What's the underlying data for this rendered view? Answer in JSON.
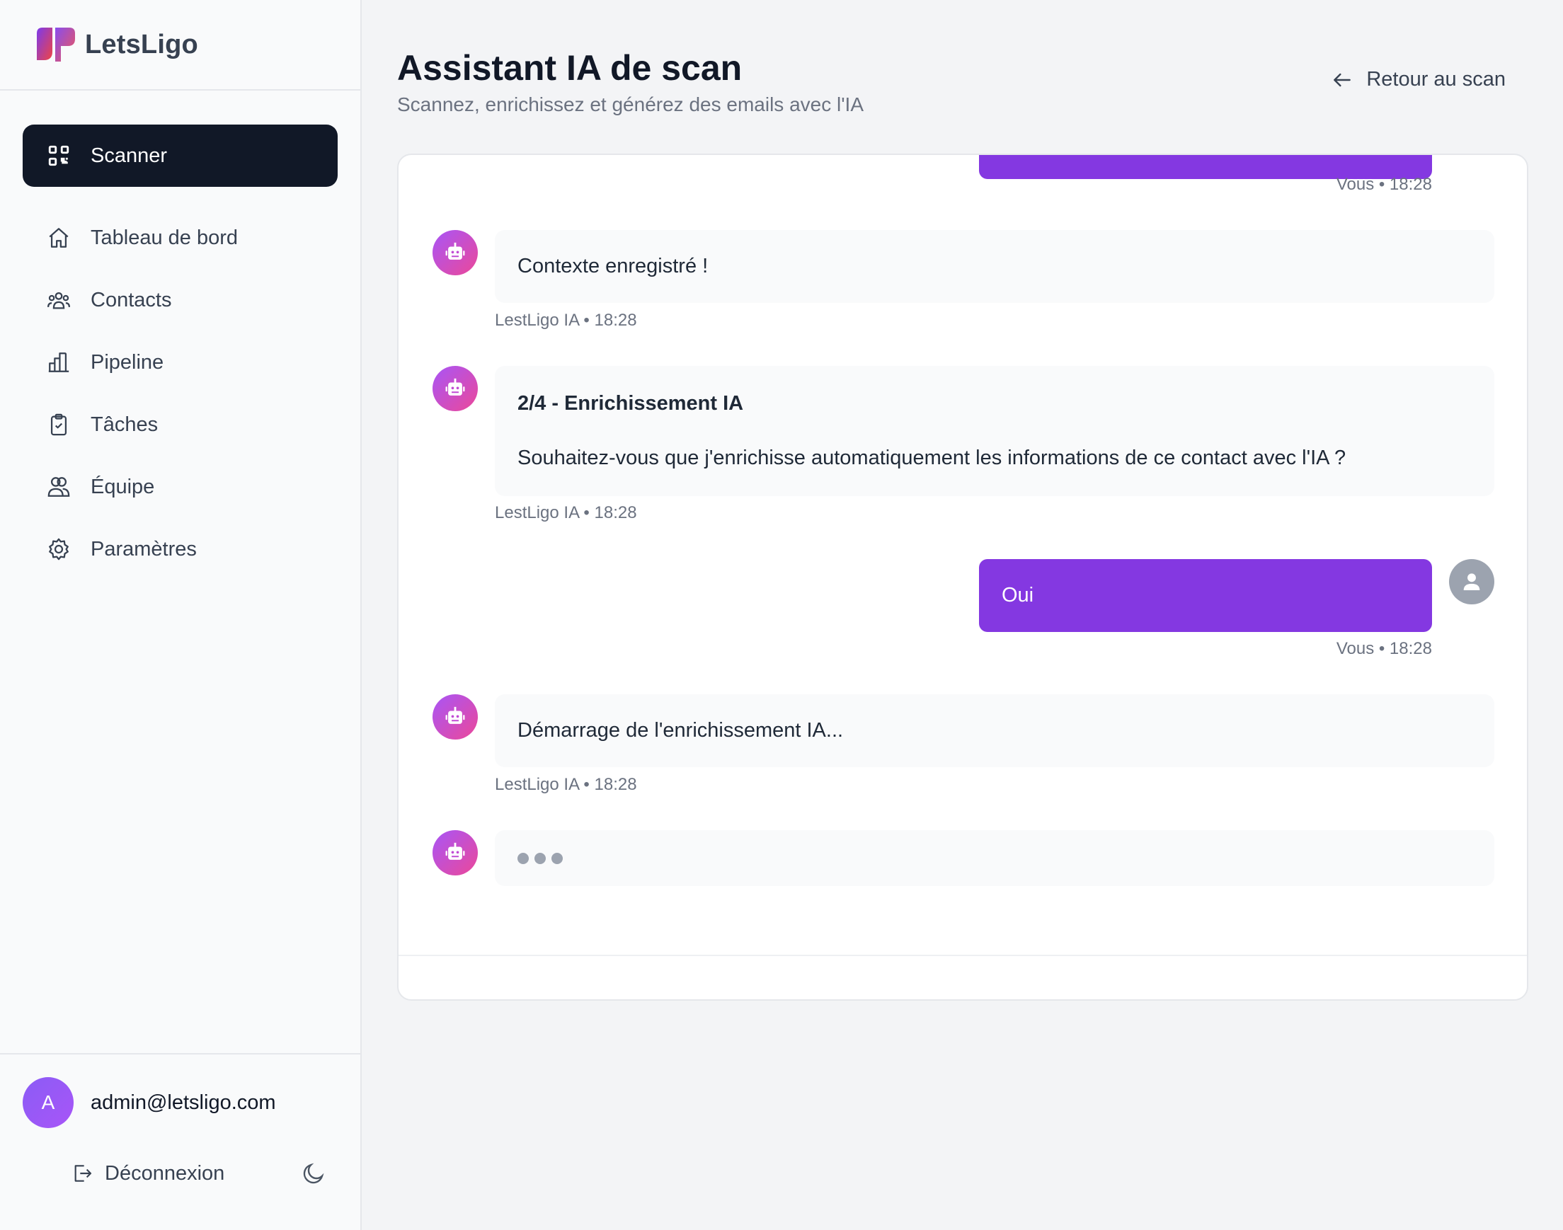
{
  "brand": {
    "name": "LetsLigo"
  },
  "sidebar": {
    "items": [
      {
        "label": "Scanner",
        "icon": "qr-scan-icon",
        "active": true
      },
      {
        "label": "Tableau de bord",
        "icon": "home-icon"
      },
      {
        "label": "Contacts",
        "icon": "users-icon"
      },
      {
        "label": "Pipeline",
        "icon": "bar-chart-icon"
      },
      {
        "label": "Tâches",
        "icon": "clipboard-check-icon"
      },
      {
        "label": "Équipe",
        "icon": "team-icon"
      },
      {
        "label": "Paramètres",
        "icon": "gear-icon"
      }
    ]
  },
  "user": {
    "initial": "A",
    "email": "admin@letsligo.com",
    "logout_label": "Déconnexion"
  },
  "header": {
    "title": "Assistant IA de scan",
    "subtitle": "Scannez, enrichissez et générez des emails avec l'IA",
    "back_label": "Retour au scan"
  },
  "chat": {
    "messages": [
      {
        "from": "user",
        "text": "",
        "meta": "Vous • 18:28"
      },
      {
        "from": "bot",
        "text": "Contexte enregistré !",
        "meta": "LestLigo IA • 18:28"
      },
      {
        "from": "bot",
        "title": "2/4 - Enrichissement IA",
        "text": "Souhaitez-vous que j'enrichisse automatiquement les informations de ce contact avec l'IA ?",
        "meta": "LestLigo IA • 18:28"
      },
      {
        "from": "user",
        "text": "Oui",
        "meta": "Vous • 18:28"
      },
      {
        "from": "bot",
        "text": "Démarrage de l'enrichissement IA...",
        "meta": "LestLigo IA • 18:28"
      },
      {
        "from": "bot",
        "typing": true
      }
    ]
  },
  "colors": {
    "accent": "#8438e1",
    "sidebar_active_bg": "#111827",
    "bot_gradient_start": "#a855f7",
    "bot_gradient_end": "#ec4899"
  }
}
